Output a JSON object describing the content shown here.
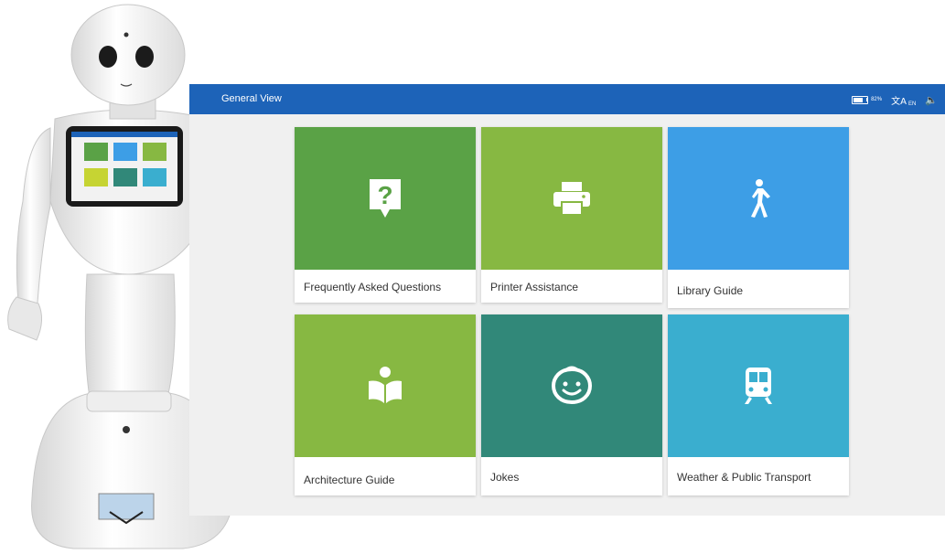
{
  "header": {
    "title": "General View",
    "battery_percent": "82%",
    "battery_level": 0.82,
    "language_code": "EN"
  },
  "colors": {
    "topbar": "#1d63b8",
    "faq": "#5aa246",
    "printer": "#87b842",
    "library": "#3d9ee6",
    "architecture": "#87b842",
    "jokes": "#318879",
    "transport": "#3aaecf"
  },
  "tiles": [
    {
      "label": "Frequently Asked Questions",
      "icon": "question-bubble-icon"
    },
    {
      "label": "Printer Assistance",
      "icon": "printer-icon"
    },
    {
      "label": "Library Guide",
      "icon": "walking-person-icon"
    },
    {
      "label": "Architecture Guide",
      "icon": "reading-person-icon"
    },
    {
      "label": "Jokes",
      "icon": "smiley-face-icon"
    },
    {
      "label": "Weather & Public Transport",
      "icon": "train-icon"
    }
  ]
}
